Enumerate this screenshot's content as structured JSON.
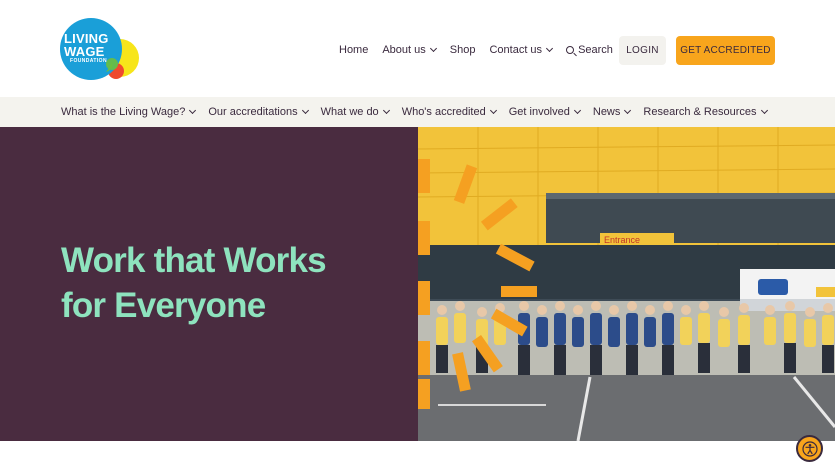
{
  "logo": {
    "line1": "LIVING",
    "line2": "WAGE",
    "line3": "FOUNDATION"
  },
  "topnav": {
    "home": "Home",
    "about": "About us",
    "shop": "Shop",
    "contact": "Contact us",
    "search": "Search",
    "login": "LOGIN",
    "accredit": "GET ACCREDITED"
  },
  "subnav": [
    {
      "label": "What is the Living Wage?"
    },
    {
      "label": "Our accreditations"
    },
    {
      "label": "What we do"
    },
    {
      "label": "Who's accredited"
    },
    {
      "label": "Get involved"
    },
    {
      "label": "News"
    },
    {
      "label": "Research & Resources"
    }
  ],
  "hero": {
    "title_line1": "Work that Works",
    "title_line2": "for Everyone",
    "photo_sign": "Entrance"
  },
  "colors": {
    "accent_orange": "#f8a51c",
    "hero_purple": "#4a2c40",
    "hero_green": "#8ee3be",
    "nav_bg": "#f4f3ee",
    "text_dark": "#3a2a3e"
  }
}
